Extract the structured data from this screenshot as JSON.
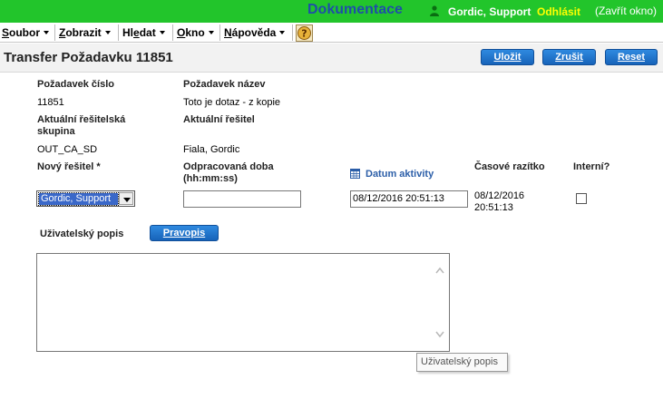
{
  "header": {
    "app_title": "Dokumentace",
    "user": "Gordic, Support",
    "logout": "Odhlásit",
    "close_window": "(Zavřít okno)"
  },
  "menu": {
    "items": [
      {
        "pre": "",
        "u": "S",
        "post": "oubor"
      },
      {
        "pre": "",
        "u": "Z",
        "post": "obrazit"
      },
      {
        "pre": "Hl",
        "u": "e",
        "post": "dat"
      },
      {
        "pre": "",
        "u": "O",
        "post": "kno"
      },
      {
        "pre": "",
        "u": "N",
        "post": "ápověda"
      }
    ]
  },
  "page": {
    "title": "Transfer Požadavku 11851",
    "save": "Uložit",
    "cancel": "Zrušit",
    "reset": "Reset"
  },
  "form": {
    "request_number_label": "Požadavek číslo",
    "request_number": "11851",
    "request_name_label": "Požadavek název",
    "request_name": "Toto je dotaz - z kopie",
    "current_group_label_1": "Aktuální řešitelská",
    "current_group_label_2": "skupina",
    "current_group": "OUT_CA_SD",
    "current_solver_label": "Aktuální řešitel",
    "current_solver": "Fiala, Gordic",
    "new_solver_label": "Nový řešitel *",
    "new_solver_value": "Gordic, Support",
    "worked_time_label_1": "Odpracovaná doba",
    "worked_time_label_2": "(hh:mm:ss)",
    "worked_time_value": "",
    "activity_date_label": "Datum aktivity",
    "activity_date_value": "08/12/2016 20:51:13",
    "timestamp_label": "Časové razítko",
    "timestamp_line1": "08/12/2016",
    "timestamp_line2": "20:51:13",
    "internal_label": "Interní?",
    "user_desc_label": "Uživatelský popis",
    "spellcheck": "Pravopis",
    "tooltip": "Uživatelský popis"
  },
  "colors": {
    "header_bg": "#22c52b",
    "title_color": "#1f4fa8",
    "logout_color": "#ffff00",
    "button_blue": "#1763b9"
  }
}
